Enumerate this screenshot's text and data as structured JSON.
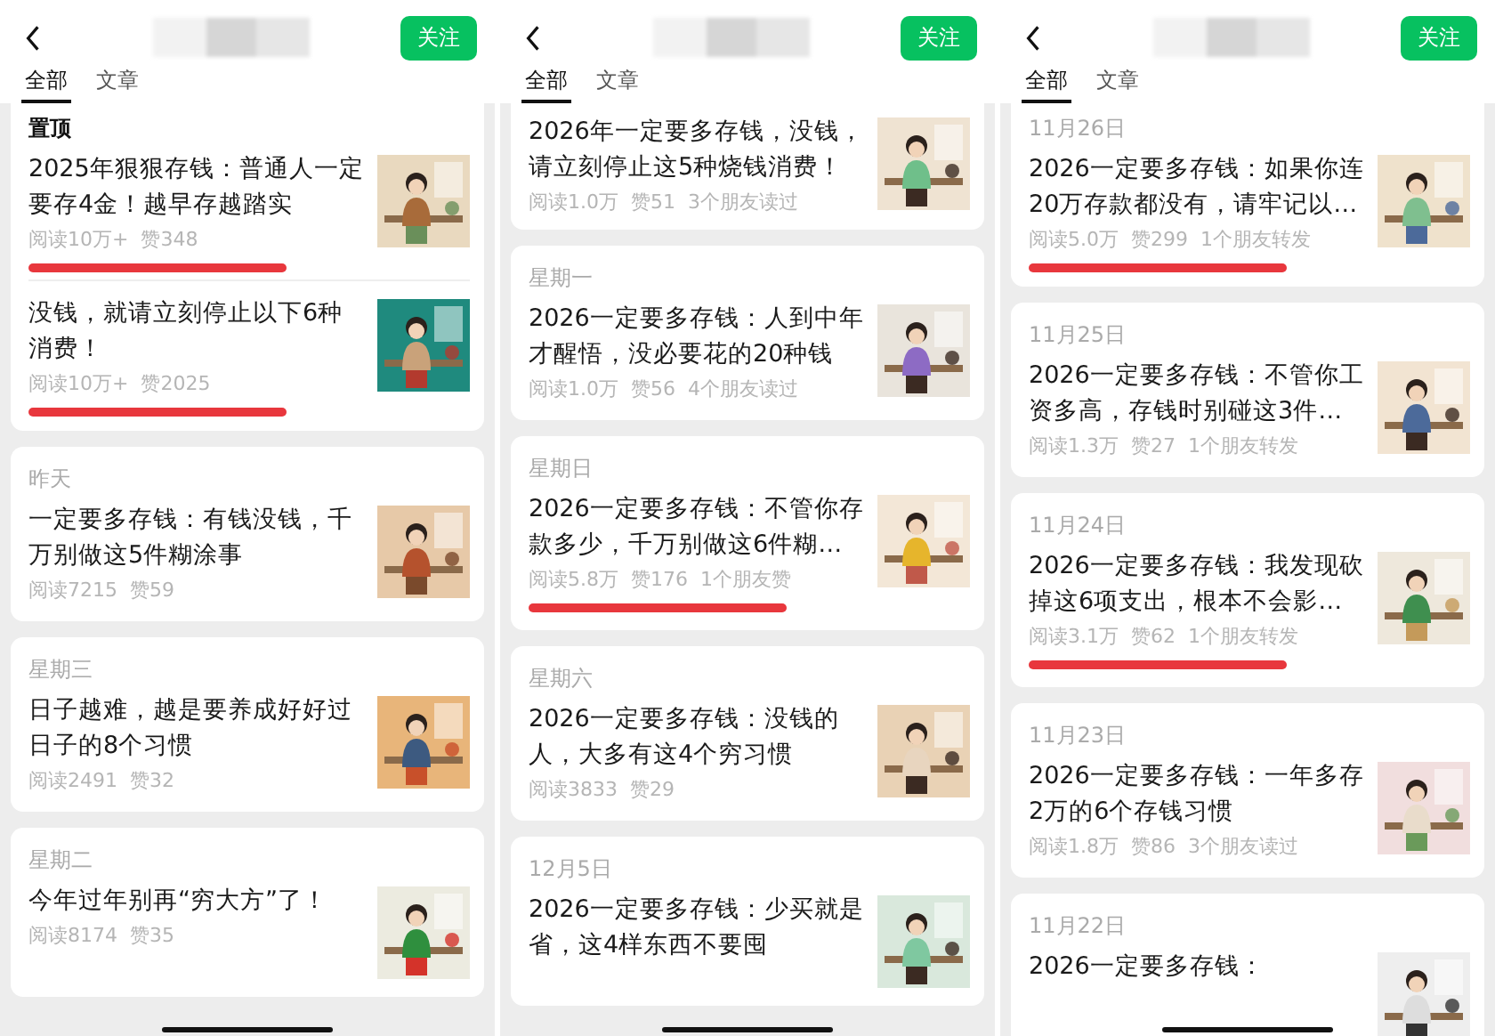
{
  "panels": [
    {
      "follow_button": "关注",
      "tabs": [
        {
          "label": "全部",
          "selected": true
        },
        {
          "label": "文章",
          "selected": false
        }
      ],
      "cards": [
        {
          "pinned": true,
          "heading": "置顶",
          "items": [
            {
              "title": "2025年狠狠存钱：普通人一定要存4金！越早存越踏实",
              "meta": [
                "阅读10万+",
                "赞348"
              ],
              "highlighted": true
            },
            {
              "title": "没钱，就请立刻停止以下6种消费！",
              "meta": [
                "阅读10万+",
                "赞2025"
              ],
              "highlighted": true
            }
          ]
        },
        {
          "pinned": false,
          "heading": "昨天",
          "items": [
            {
              "title": "一定要多存钱：有钱没钱，千万别做这5件糊涂事",
              "meta": [
                "阅读7215",
                "赞59"
              ],
              "highlighted": false
            }
          ]
        },
        {
          "pinned": false,
          "heading": "星期三",
          "items": [
            {
              "title": "日子越难，越是要养成好好过日子的8个习惯",
              "meta": [
                "阅读2491",
                "赞32"
              ],
              "highlighted": false
            }
          ]
        },
        {
          "pinned": false,
          "heading": "星期二",
          "items": [
            {
              "title": "今年过年别再“穷大方”了！",
              "meta": [
                "阅读8174",
                "赞35"
              ],
              "highlighted": false
            }
          ]
        }
      ]
    },
    {
      "follow_button": "关注",
      "tabs": [
        {
          "label": "全部",
          "selected": true
        },
        {
          "label": "文章",
          "selected": false
        }
      ],
      "cards": [
        {
          "items": [
            {
              "title": "2026年一定要多存钱，没钱，请立刻停止这5种烧钱消费！",
              "meta": [
                "阅读1.0万",
                "赞51",
                "3个朋友读过"
              ],
              "highlighted": false
            }
          ]
        },
        {
          "pinned": false,
          "heading": "星期一",
          "items": [
            {
              "title": "2026一定要多存钱：人到中年才醒悟，没必要花的20种钱",
              "meta": [
                "阅读1.0万",
                "赞56",
                "4个朋友读过"
              ],
              "highlighted": false
            }
          ]
        },
        {
          "pinned": false,
          "heading": "星期日",
          "items": [
            {
              "title": "2026一定要多存钱：不管你存款多少，千万别做这6件糊…",
              "meta": [
                "阅读5.8万",
                "赞176",
                "1个朋友赞"
              ],
              "highlighted": true
            }
          ]
        },
        {
          "pinned": false,
          "heading": "星期六",
          "items": [
            {
              "title": "2026一定要多存钱：没钱的人，大多有这4个穷习惯",
              "meta": [
                "阅读3833",
                "赞29"
              ],
              "highlighted": false
            }
          ]
        },
        {
          "pinned": false,
          "heading": "12月5日",
          "items": [
            {
              "title": "2026一定要多存钱：少买就是省，这4样东西不要囤",
              "highlighted": false
            }
          ]
        }
      ]
    },
    {
      "follow_button": "关注",
      "tabs": [
        {
          "label": "全部",
          "selected": true
        },
        {
          "label": "文章",
          "selected": false
        }
      ],
      "cards": [
        {
          "pinned": false,
          "heading": "11月26日",
          "items": [
            {
              "title": "2026一定要多存钱：如果你连20万存款都没有，请牢记以…",
              "meta": [
                "阅读5.0万",
                "赞299",
                "1个朋友转发"
              ],
              "highlighted": true
            }
          ]
        },
        {
          "pinned": false,
          "heading": "11月25日",
          "items": [
            {
              "title": "2026一定要多存钱：不管你工资多高，存钱时别碰这3件…",
              "meta": [
                "阅读1.3万",
                "赞27",
                "1个朋友转发"
              ],
              "highlighted": false
            }
          ]
        },
        {
          "pinned": false,
          "heading": "11月24日",
          "items": [
            {
              "title": "2026一定要多存钱：我发现砍掉这6项支出，根本不会影…",
              "meta": [
                "阅读3.1万",
                "赞62",
                "1个朋友转发"
              ],
              "highlighted": true
            }
          ]
        },
        {
          "pinned": false,
          "heading": "11月23日",
          "items": [
            {
              "title": "2026一定要多存钱：一年多存2万的6个存钱习惯",
              "meta": [
                "阅读1.8万",
                "赞86",
                "3个朋友读过"
              ],
              "highlighted": false
            }
          ]
        },
        {
          "pinned": false,
          "heading": "11月22日",
          "items": [
            {
              "title": "2026一定要多存钱：",
              "highlighted": false
            }
          ]
        }
      ]
    }
  ]
}
